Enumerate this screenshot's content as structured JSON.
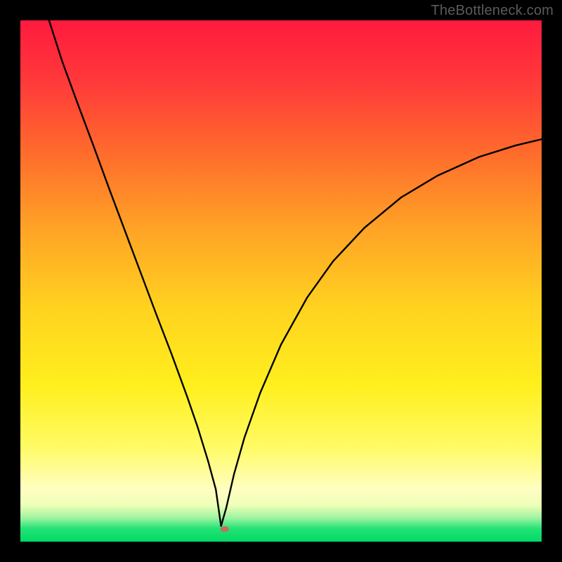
{
  "watermark": "TheBottleneck.com",
  "chart_data": {
    "type": "line",
    "title": "",
    "xlabel": "",
    "ylabel": "",
    "xlim": [
      0,
      100
    ],
    "ylim": [
      0,
      100
    ],
    "x_notch": 38.5,
    "background_gradient": [
      {
        "pos": 0.0,
        "color": "#ff1a3e"
      },
      {
        "pos": 0.12,
        "color": "#ff3a3a"
      },
      {
        "pos": 0.25,
        "color": "#ff6a2c"
      },
      {
        "pos": 0.4,
        "color": "#ffa326"
      },
      {
        "pos": 0.55,
        "color": "#ffd21f"
      },
      {
        "pos": 0.7,
        "color": "#ffef1d"
      },
      {
        "pos": 0.82,
        "color": "#fffb66"
      },
      {
        "pos": 0.9,
        "color": "#fffec2"
      },
      {
        "pos": 0.93,
        "color": "#eeffb8"
      },
      {
        "pos": 0.955,
        "color": "#9bf3a0"
      },
      {
        "pos": 0.975,
        "color": "#23e276"
      },
      {
        "pos": 1.0,
        "color": "#00d965"
      }
    ],
    "marker": {
      "x": 39.2,
      "y": 2.4,
      "color": "#cc6a5c",
      "rx": 6,
      "ry": 4
    },
    "series": [
      {
        "name": "curve",
        "x": [
          5.5,
          8,
          11,
          14,
          17,
          20,
          23,
          26,
          29,
          32,
          34,
          36,
          37.5,
          38.5,
          39.5,
          41,
          43,
          46,
          50,
          55,
          60,
          66,
          73,
          80,
          88,
          95,
          100
        ],
        "values": [
          100,
          92.2,
          84,
          76,
          67.8,
          59.8,
          51.8,
          43.8,
          36,
          27.8,
          22,
          15.5,
          10,
          3,
          6.5,
          13,
          20,
          28.5,
          37.8,
          46.8,
          53.8,
          60.2,
          66,
          70.2,
          73.8,
          76,
          77.2
        ]
      }
    ]
  }
}
